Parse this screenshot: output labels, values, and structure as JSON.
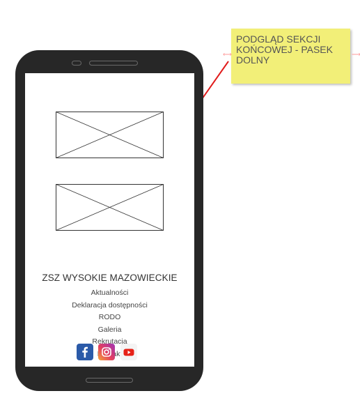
{
  "annotation": {
    "note_text": "PODGLĄD SEKCJI KOŃCOWEJ - PASEK DOLNY",
    "note_color": "#f2ef78",
    "arrow_color": "#e11b1b"
  },
  "footer": {
    "title": "ZSZ WYSOKIE MAZOWIECKIE",
    "menu": [
      "Aktualności",
      "Deklaracja dostępności",
      "RODO",
      "Galeria",
      "Rekrutacja",
      "Kontakt"
    ],
    "social_icons": [
      "facebook-icon",
      "instagram-icon",
      "youtube-icon"
    ]
  },
  "device": {
    "frame_color": "#272727"
  }
}
